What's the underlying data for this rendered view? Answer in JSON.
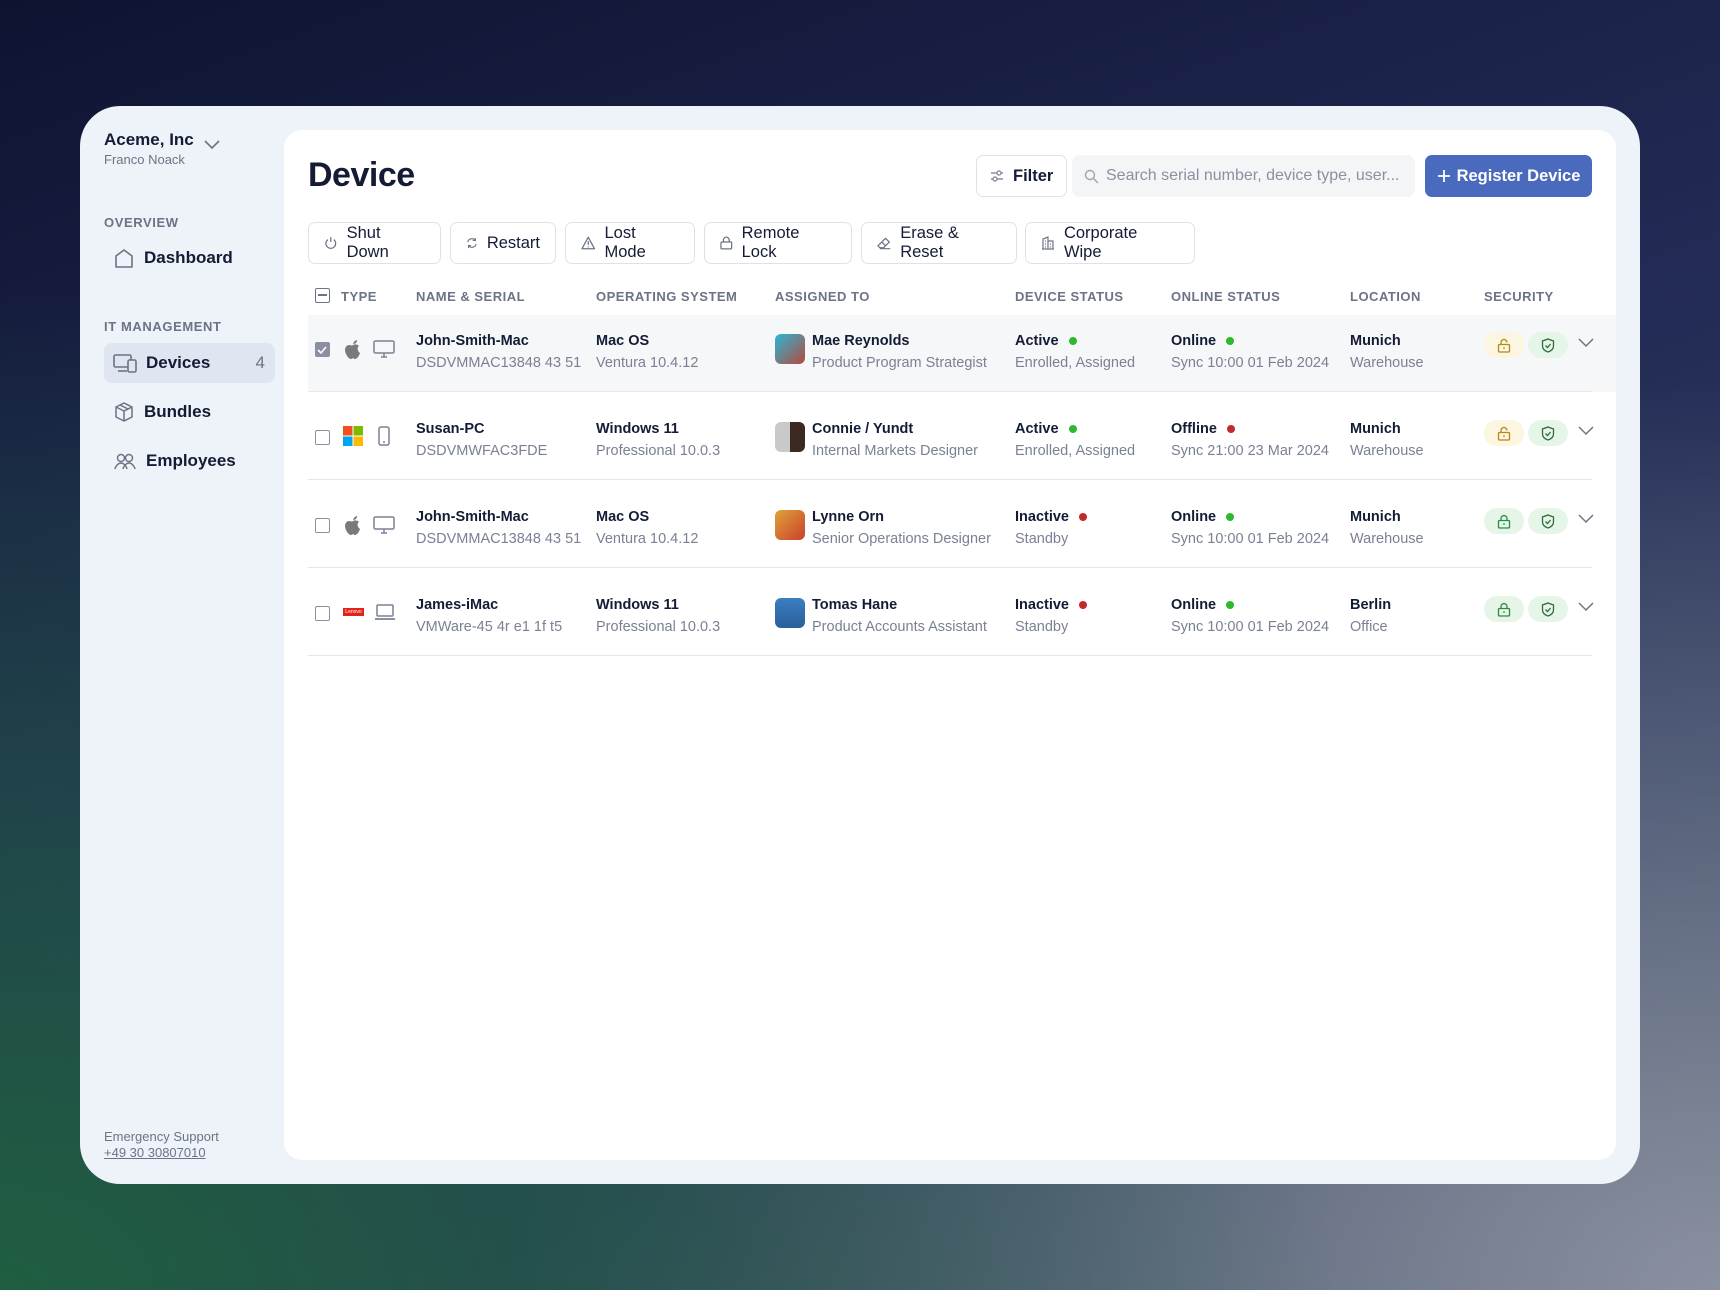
{
  "sidebar": {
    "org": "Aceme, Inc",
    "user": "Franco Noack",
    "overview_label": "OVERVIEW",
    "dashboard": "Dashboard",
    "it_label": "IT MANAGEMENT",
    "items": [
      {
        "label": "Devices",
        "count": "4"
      },
      {
        "label": "Bundles"
      },
      {
        "label": "Employees"
      }
    ],
    "support_label": "Emergency Support",
    "support_phone": "+49 30 30807010"
  },
  "header": {
    "title": "Device",
    "filter": "Filter",
    "search_placeholder": "Search serial number, device type, user...",
    "register": "Register Device"
  },
  "actions": [
    "Shut Down",
    "Restart",
    "Lost Mode",
    "Remote Lock",
    "Erase & Reset",
    "Corporate Wipe"
  ],
  "columns": [
    "TYPE",
    "NAME & SERIAL",
    "OPERATING SYSTEM",
    "ASSIGNED TO",
    "DEVICE STATUS",
    "ONLINE STATUS",
    "LOCATION",
    "SECURITY"
  ],
  "colors": {
    "accent": "#4a6bbd",
    "green": "#2eb82e",
    "red": "#c42a2a"
  },
  "rows": [
    {
      "checked": true,
      "brand": "apple",
      "device": "desktop",
      "name": "John-Smith-Mac",
      "serial": "DSDVMMAC13848 43 51",
      "os": "Mac OS",
      "os_ver": "Ventura 10.4.12",
      "person": "Mae Reynolds",
      "role": "Product Program Strategist",
      "status": "Active",
      "status_sub": "Enrolled, Assigned",
      "online": "Online",
      "sync": "Sync 10:00 01 Feb 2024",
      "city": "Munich",
      "site": "Warehouse",
      "lock": "unlocked"
    },
    {
      "checked": false,
      "brand": "windows",
      "device": "phone",
      "name": "Susan-PC",
      "serial": "DSDVMWFAC3FDE",
      "os": "Windows 11",
      "os_ver": "Professional 10.0.3",
      "person": "Connie / Yundt",
      "role": "Internal Markets Designer",
      "status": "Active",
      "status_sub": "Enrolled, Assigned",
      "online": "Offline",
      "sync": "Sync 21:00 23 Mar 2024",
      "city": "Munich",
      "site": "Warehouse",
      "lock": "unlocked"
    },
    {
      "checked": false,
      "brand": "apple",
      "device": "desktop",
      "name": "John-Smith-Mac",
      "serial": "DSDVMMAC13848 43 51",
      "os": "Mac OS",
      "os_ver": "Ventura 10.4.12",
      "person": "Lynne Orn",
      "role": "Senior Operations Designer",
      "status": "Inactive",
      "status_sub": "Standby",
      "online": "Online",
      "sync": "Sync 10:00 01 Feb 2024",
      "city": "Munich",
      "site": "Warehouse",
      "lock": "locked"
    },
    {
      "checked": false,
      "brand": "lenovo",
      "brand_text": "Lenovo",
      "device": "laptop",
      "name": "James-iMac",
      "serial": "VMWare-45 4r e1 1f t5",
      "os": "Windows 11",
      "os_ver": "Professional 10.0.3",
      "person": "Tomas Hane",
      "role": "Product Accounts Assistant",
      "status": "Inactive",
      "status_sub": "Standby",
      "online": "Online",
      "sync": "Sync 10:00 01 Feb 2024",
      "city": "Berlin",
      "site": "Office",
      "lock": "locked"
    }
  ]
}
